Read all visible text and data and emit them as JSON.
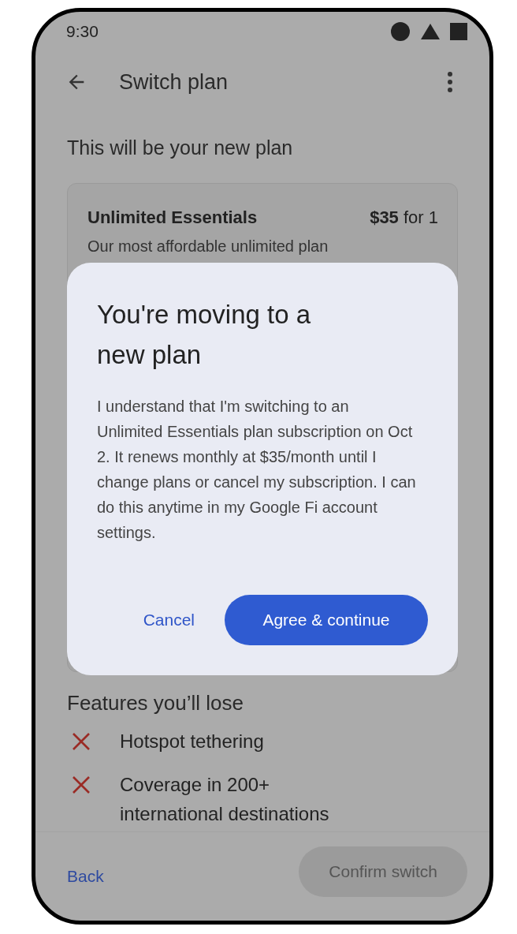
{
  "status_bar": {
    "time": "9:30"
  },
  "app_bar": {
    "title": "Switch plan"
  },
  "heading": "This will be your new plan",
  "plan_card": {
    "name": "Unlimited Essentials",
    "price": "**$35** for 1",
    "description": "Our most affordable unlimited plan"
  },
  "features_lost": {
    "title": "Features you’ll lose",
    "items": [
      "Hotspot tethering",
      "Coverage in 200+ international destinations"
    ]
  },
  "bottom_bar": {
    "back": "Back",
    "confirm": {
      "label": "Confirm switch",
      "disabled": true
    }
  },
  "dialog": {
    "title": "You're moving to a new plan",
    "body": "I understand that I'm switching to an Unlimited Essentials plan subscription on Oct 2. It renews monthly at $35/month until I change plans or cancel my subscription. I can do this anytime in my Google Fi account settings.",
    "cancel": "Cancel",
    "confirm": "Agree & continue"
  }
}
